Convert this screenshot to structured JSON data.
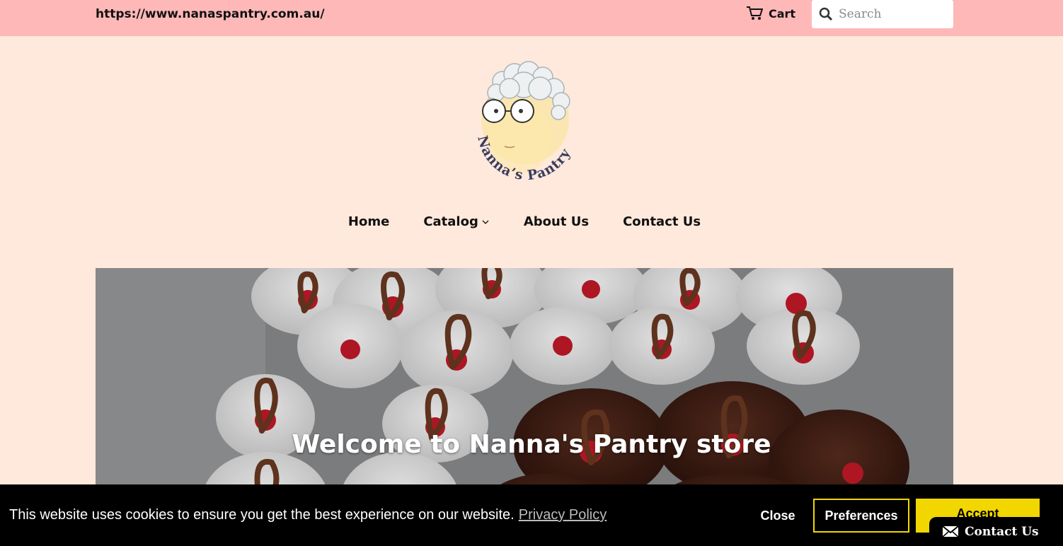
{
  "topbar": {
    "url": "https://www.nanaspantry.com.au/",
    "cart_label": "Cart",
    "search_placeholder": "Search"
  },
  "logo": {
    "text": "Nanna’s Pantry",
    "icon": "grandma-face-logo"
  },
  "nav": {
    "items": [
      {
        "label": "Home"
      },
      {
        "label": "Catalog",
        "has_dropdown": true
      },
      {
        "label": "About Us"
      },
      {
        "label": "Contact Us"
      }
    ]
  },
  "hero": {
    "title": "Welcome to Nanna's Pantry store",
    "image": "cupcakes-with-cherries"
  },
  "cookie_banner": {
    "message": "This website uses cookies to ensure you get the best experience on our website.",
    "policy_link": "Privacy Policy",
    "close_label": "Close",
    "preferences_label": "Preferences",
    "accept_label": "Accept"
  },
  "contact_widget": {
    "label": "Contact Us",
    "icon": "envelope-icon"
  },
  "colors": {
    "topbar": "#ffb8b8",
    "background": "#ffe9dc",
    "accent": "#f1d600"
  }
}
